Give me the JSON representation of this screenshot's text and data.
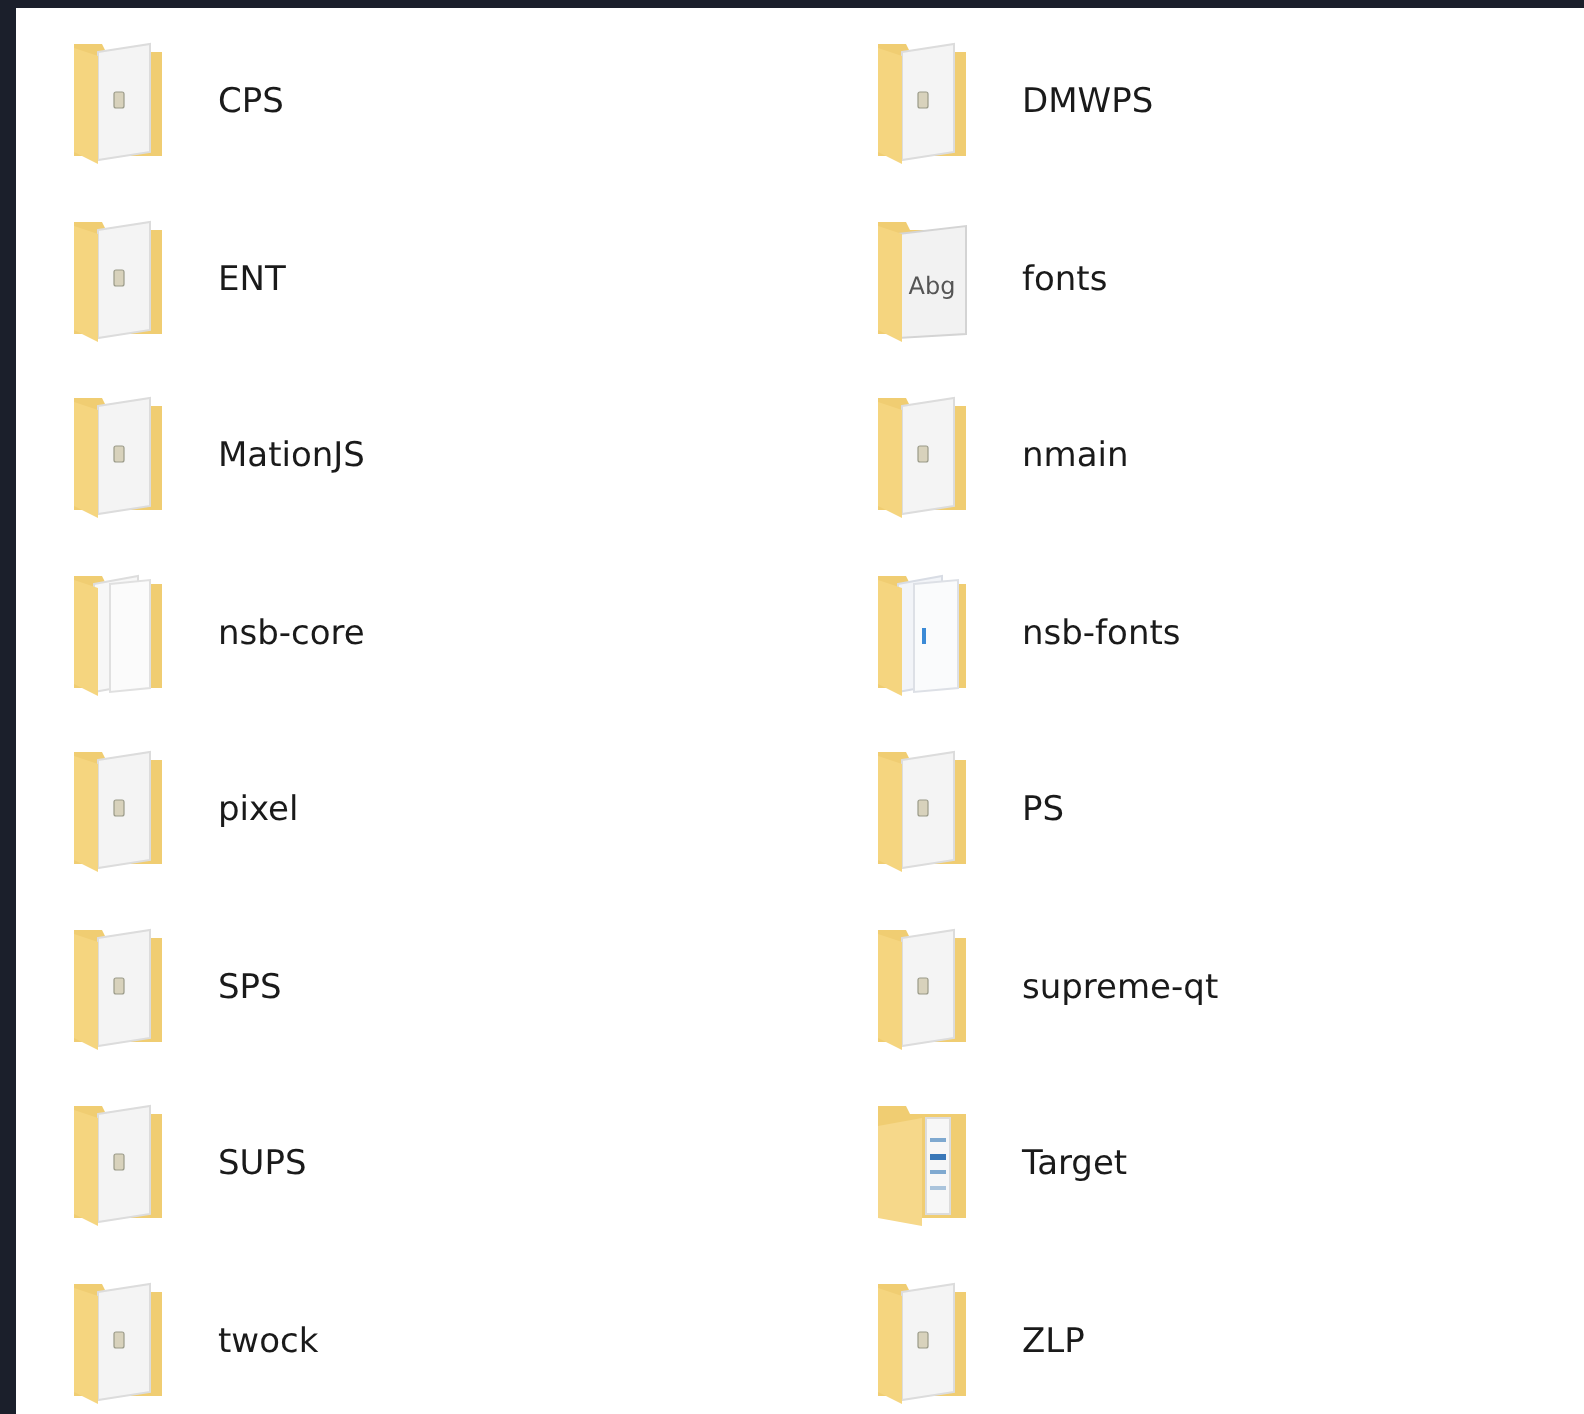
{
  "folders": [
    {
      "name": "CPS",
      "kind": "script"
    },
    {
      "name": "DMWPS",
      "kind": "script"
    },
    {
      "name": "ENT",
      "kind": "script"
    },
    {
      "name": "fonts",
      "kind": "font",
      "preview_text": "Abg"
    },
    {
      "name": "MationJS",
      "kind": "script"
    },
    {
      "name": "nmain",
      "kind": "script"
    },
    {
      "name": "nsb-core",
      "kind": "blank"
    },
    {
      "name": "nsb-fonts",
      "kind": "pages"
    },
    {
      "name": "pixel",
      "kind": "script"
    },
    {
      "name": "PS",
      "kind": "script"
    },
    {
      "name": "SPS",
      "kind": "script"
    },
    {
      "name": "supreme-qt",
      "kind": "script"
    },
    {
      "name": "SUPS",
      "kind": "script"
    },
    {
      "name": "Target",
      "kind": "open"
    },
    {
      "name": "twock",
      "kind": "script"
    },
    {
      "name": "ZLP",
      "kind": "script"
    }
  ]
}
